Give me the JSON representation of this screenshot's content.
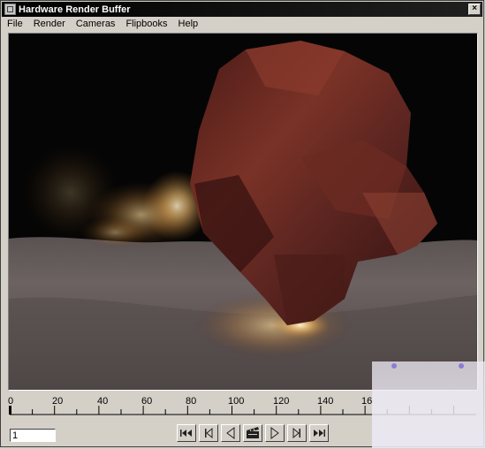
{
  "window": {
    "title": "Hardware Render Buffer",
    "close_glyph": "×"
  },
  "menu": {
    "items": [
      "File",
      "Render",
      "Cameras",
      "Flipbooks",
      "Help"
    ]
  },
  "viewport": {
    "content": "particle simulation render: rock impacting sandy ground with glowing particle spray"
  },
  "timeline": {
    "ticks": [
      "0",
      "20",
      "40",
      "60",
      "80",
      "100",
      "120",
      "140",
      "16"
    ]
  },
  "controls": {
    "frame_value": "1",
    "buttons": [
      {
        "name": "rewind-button",
        "icon": "rewind-icon"
      },
      {
        "name": "step-back-button",
        "icon": "step-back-icon"
      },
      {
        "name": "play-backward-button",
        "icon": "play-backward-icon"
      },
      {
        "name": "clapper-button",
        "icon": "clapperboard-icon"
      },
      {
        "name": "play-forward-button",
        "icon": "play-forward-icon"
      },
      {
        "name": "step-forward-button",
        "icon": "step-forward-icon"
      },
      {
        "name": "fast-forward-button",
        "icon": "fast-forward-icon"
      }
    ]
  },
  "colors": {
    "titlebar": "#000000",
    "chrome": "#d4d0c8",
    "viewport_bg": "#050505",
    "ground": "#6f6565",
    "rock": "#6a2a20",
    "particles": "#ffd890"
  }
}
